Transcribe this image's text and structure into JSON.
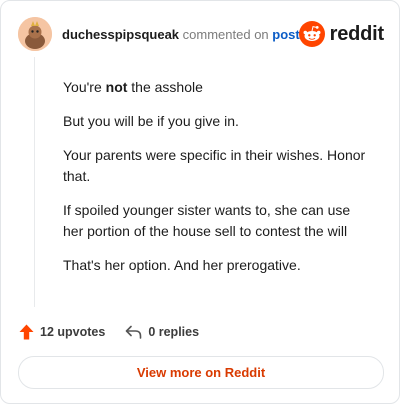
{
  "header": {
    "username": "duchesspipsqueak",
    "action_text": "commented on",
    "post_link": "post",
    "logo_text": "reddit"
  },
  "comment": {
    "paragraphs": [
      {
        "prefix": "You're ",
        "bold": "not",
        "suffix": " the asshole"
      },
      {
        "text": "But you will be if you give in."
      },
      {
        "text": "Your parents were specific in their wishes. Honor that."
      },
      {
        "text": "If spoiled younger sister wants to, she can use her portion of the house sell to contest the will"
      },
      {
        "text": "That's her option. And her prerogative."
      }
    ]
  },
  "footer": {
    "upvotes_label": "12 upvotes",
    "replies_label": "0 replies",
    "upvote_icon": "upvote-arrow-icon",
    "reply_icon": "reply-arrow-icon"
  },
  "view_more_label": "View more on Reddit",
  "colors": {
    "reddit_orange": "#ff4500",
    "link_blue": "#0b5cc6",
    "cta_orange": "#d93a00"
  }
}
